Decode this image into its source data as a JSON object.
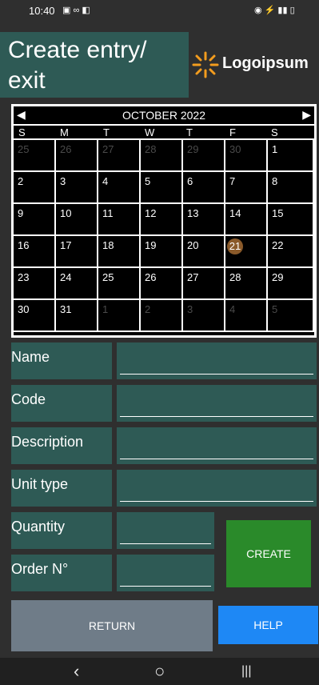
{
  "status_bar": {
    "time": "10:40",
    "left_icons": "▣ ∞ ◧",
    "right_icons": "◉ ⚡ ▮▮ ▯"
  },
  "header": {
    "title": "Create entry/ exit",
    "logo_text": "Logoipsum",
    "logo_color": "#f39c1e"
  },
  "calendar": {
    "month_label": "OCTOBER 2022",
    "prev_icon": "◀",
    "next_icon": "▶",
    "weekdays": [
      "S",
      "M",
      "T",
      "W",
      "T",
      "F",
      "S"
    ],
    "selected_day": "21",
    "weeks": [
      [
        {
          "d": "25",
          "m": true
        },
        {
          "d": "26",
          "m": true
        },
        {
          "d": "27",
          "m": true
        },
        {
          "d": "28",
          "m": true
        },
        {
          "d": "29",
          "m": true
        },
        {
          "d": "30",
          "m": true
        },
        {
          "d": "1",
          "m": false
        }
      ],
      [
        {
          "d": "2",
          "m": false
        },
        {
          "d": "3",
          "m": false
        },
        {
          "d": "4",
          "m": false
        },
        {
          "d": "5",
          "m": false
        },
        {
          "d": "6",
          "m": false
        },
        {
          "d": "7",
          "m": false
        },
        {
          "d": "8",
          "m": false
        }
      ],
      [
        {
          "d": "9",
          "m": false
        },
        {
          "d": "10",
          "m": false
        },
        {
          "d": "11",
          "m": false
        },
        {
          "d": "12",
          "m": false
        },
        {
          "d": "13",
          "m": false
        },
        {
          "d": "14",
          "m": false
        },
        {
          "d": "15",
          "m": false
        }
      ],
      [
        {
          "d": "16",
          "m": false
        },
        {
          "d": "17",
          "m": false
        },
        {
          "d": "18",
          "m": false
        },
        {
          "d": "19",
          "m": false
        },
        {
          "d": "20",
          "m": false
        },
        {
          "d": "21",
          "m": false
        },
        {
          "d": "22",
          "m": false
        }
      ],
      [
        {
          "d": "23",
          "m": false
        },
        {
          "d": "24",
          "m": false
        },
        {
          "d": "25",
          "m": false
        },
        {
          "d": "26",
          "m": false
        },
        {
          "d": "27",
          "m": false
        },
        {
          "d": "28",
          "m": false
        },
        {
          "d": "29",
          "m": false
        }
      ],
      [
        {
          "d": "30",
          "m": false
        },
        {
          "d": "31",
          "m": false
        },
        {
          "d": "1",
          "m": true
        },
        {
          "d": "2",
          "m": true
        },
        {
          "d": "3",
          "m": true
        },
        {
          "d": "4",
          "m": true
        },
        {
          "d": "5",
          "m": true
        }
      ]
    ]
  },
  "form": {
    "name_label": "Name",
    "code_label": "Code",
    "description_label": "Description",
    "unit_type_label": "Unit type",
    "quantity_label": "Quantity",
    "order_label": "Order N°"
  },
  "buttons": {
    "create": "CREATE",
    "return": "RETURN",
    "help": "HELP"
  },
  "nav": {
    "back": "‹",
    "home": "○",
    "recents": "|||"
  },
  "colors": {
    "panel": "#2e5a55",
    "create": "#2a8a2a",
    "return": "#6f7c88",
    "help": "#1e88f5",
    "today": "#8a5a2a"
  }
}
